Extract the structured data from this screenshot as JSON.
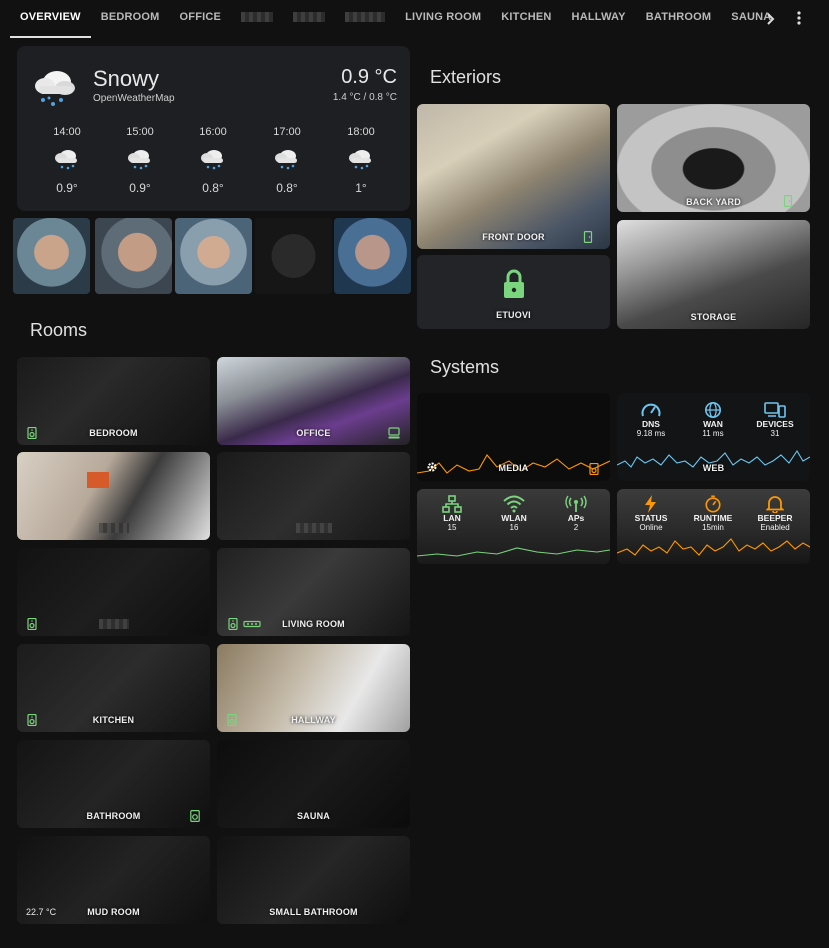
{
  "tabs": [
    {
      "label": "OVERVIEW",
      "active": true
    },
    {
      "label": "BEDROOM"
    },
    {
      "label": "OFFICE"
    },
    {
      "label": "",
      "blurred": true
    },
    {
      "label": "",
      "blurred": true
    },
    {
      "label": "",
      "blurred": true
    },
    {
      "label": "LIVING ROOM"
    },
    {
      "label": "KITCHEN"
    },
    {
      "label": "HALLWAY"
    },
    {
      "label": "BATHROOM"
    },
    {
      "label": "SAUNA"
    }
  ],
  "tab_more_icon": "chevron-right-icon",
  "menu_icon": "dots-vertical-icon",
  "weather": {
    "condition": "Snowy",
    "source": "OpenWeatherMap",
    "temperature": "0.9 °C",
    "range": "1.4 °C / 0.8 °C",
    "icon": "snowy-cloud-icon",
    "forecast": [
      {
        "time": "14:00",
        "temp": "0.9°"
      },
      {
        "time": "15:00",
        "temp": "0.9°"
      },
      {
        "time": "16:00",
        "temp": "0.8°"
      },
      {
        "time": "17:00",
        "temp": "0.8°"
      },
      {
        "time": "18:00",
        "temp": "1°"
      }
    ]
  },
  "sections": {
    "rooms": "Rooms",
    "exteriors": "Exteriors",
    "systems": "Systems"
  },
  "rooms": [
    {
      "label": "BEDROOM",
      "icon": "speaker-icon"
    },
    {
      "label": "OFFICE",
      "icon": "computer-icon"
    },
    {
      "label": ""
    },
    {
      "label": ""
    },
    {
      "label": "",
      "icon": "speaker-icon"
    },
    {
      "label": "LIVING ROOM",
      "icon": "speaker-icon"
    },
    {
      "label": "KITCHEN",
      "icon": "speaker-icon"
    },
    {
      "label": "HALLWAY",
      "icon": "speaker-icon"
    },
    {
      "label": "BATHROOM",
      "icon": "washer-icon"
    },
    {
      "label": "SAUNA"
    },
    {
      "label": "MUD ROOM",
      "temp": "22.7 °C"
    },
    {
      "label": "SMALL BATHROOM"
    }
  ],
  "exteriors": {
    "front_door": "FRONT DOOR",
    "back_yard": "BACK YARD",
    "lock": "ETUOVI",
    "storage": "STORAGE"
  },
  "systems": {
    "media": "MEDIA",
    "web": "WEB",
    "dns": {
      "label": "DNS",
      "value": "9.18 ms"
    },
    "wan": {
      "label": "WAN",
      "value": "11 ms"
    },
    "devices": {
      "label": "DEVICES",
      "value": "31"
    },
    "lan": {
      "label": "LAN",
      "value": "15"
    },
    "wlan": {
      "label": "WLAN",
      "value": "16"
    },
    "aps": {
      "label": "APs",
      "value": "2"
    },
    "status": {
      "label": "STATUS",
      "value": "Online"
    },
    "runtime": {
      "label": "RUNTIME",
      "value": "15min"
    },
    "beeper": {
      "label": "BEEPER",
      "value": "Enabled"
    }
  },
  "colors": {
    "accent_green": "#7bd47e",
    "accent_orange": "#ff9800",
    "accent_blue": "#6ec6f0",
    "card_bg": "#1d1f22"
  }
}
